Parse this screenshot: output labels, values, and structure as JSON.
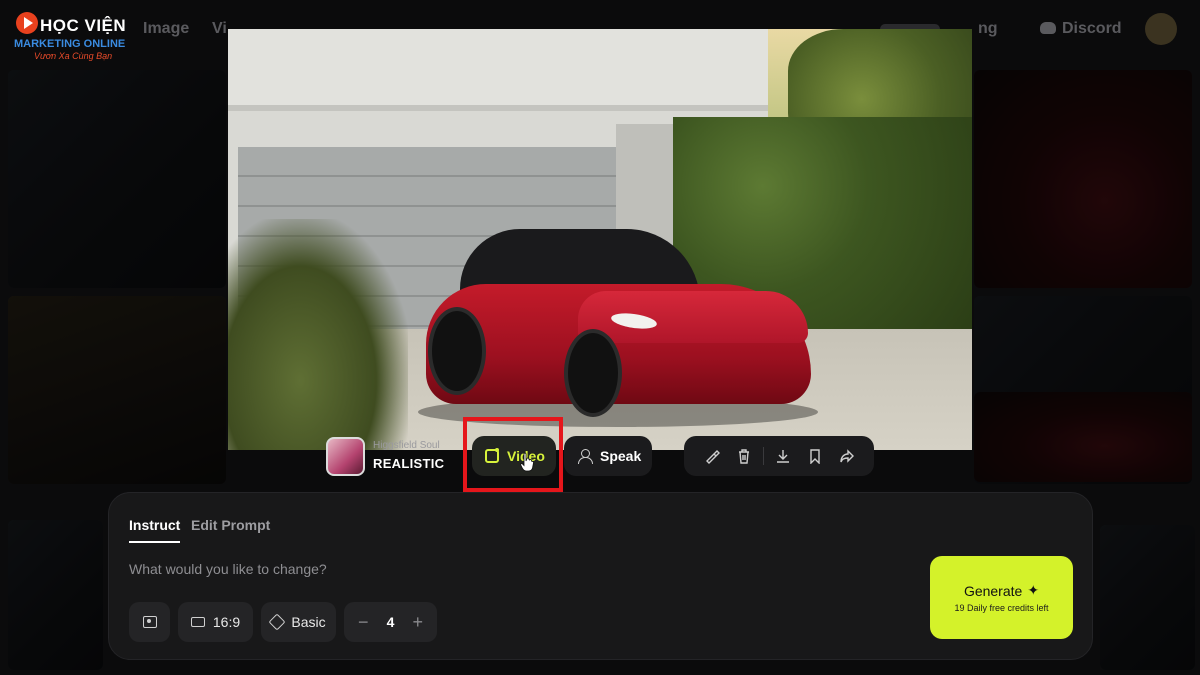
{
  "logo": {
    "title": "HỌC VIỆN",
    "subtitle": "MARKETING ONLINE",
    "tagline": "Vươn Xa Cùng Bạn"
  },
  "nav": {
    "items": [
      "Image",
      "Vi"
    ],
    "right_items": [
      "ng"
    ],
    "discord_label": "Discord"
  },
  "model": {
    "provider": "Higgsfield Soul",
    "style": "REALISTIC"
  },
  "actions": {
    "video_label": "Video",
    "speak_label": "Speak",
    "tools": [
      "brush-icon",
      "trash-icon",
      "download-icon",
      "bookmark-icon",
      "share-icon"
    ]
  },
  "prompt_panel": {
    "tabs": [
      {
        "label": "Instruct",
        "active": true
      },
      {
        "label": "Edit Prompt",
        "active": false
      }
    ],
    "placeholder": "What would you like to change?",
    "aspect_ratio": "16:9",
    "quality": "Basic",
    "count": "4",
    "count_minus": "−",
    "count_plus": "+",
    "generate_label": "Generate",
    "credits_text": "19 Daily free credits left"
  },
  "colors": {
    "accent": "#d4f22a",
    "highlight": "#e5161b",
    "panel": "#181819"
  }
}
